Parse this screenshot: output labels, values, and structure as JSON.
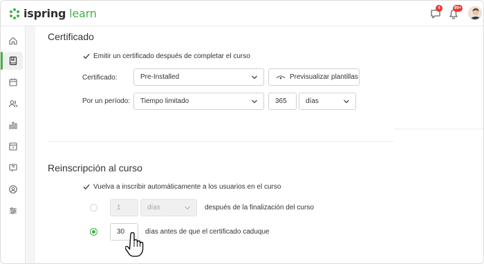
{
  "header": {
    "brand_bold": "ispring",
    "brand_light": "learn",
    "chat_badge": "4",
    "notif_badge": "99+",
    "icons": [
      "chat-icon",
      "bell-icon",
      "user-avatar"
    ]
  },
  "sidebar": {
    "items": [
      {
        "icon": "home-icon",
        "active": false
      },
      {
        "icon": "course-book-icon",
        "active": true
      },
      {
        "icon": "calendar-icon",
        "active": false
      },
      {
        "icon": "users-icon",
        "active": false
      },
      {
        "icon": "bar-chart-icon",
        "active": false
      },
      {
        "icon": "archive-icon",
        "active": false
      },
      {
        "icon": "help-chat-icon",
        "active": false
      },
      {
        "icon": "person-search-icon",
        "active": false
      },
      {
        "icon": "sliders-icon",
        "active": false
      }
    ]
  },
  "certificate": {
    "title": "Certificado",
    "issue_checkbox_label": "Emitir un certificado después de completar el curso",
    "cert_label": "Certificado:",
    "cert_value": "Pre-Installed",
    "preview_button": "Previsualizar plantillas",
    "period_label": "Por un período:",
    "period_value": "Tiempo limitado",
    "period_amount": "365",
    "period_unit": "días"
  },
  "reenrollment": {
    "title": "Reinscripción al curso",
    "auto_checkbox_label": "Vuelva a inscribir automáticamente a los usuarios en el curso",
    "option1_value": "1",
    "option1_unit": "días",
    "option1_text": "después de la finalización del curso",
    "option2_value": "30",
    "option2_text": "días antes de que el certificado caduque"
  },
  "colors": {
    "accent": "#43b049",
    "badge": "#e53935"
  }
}
